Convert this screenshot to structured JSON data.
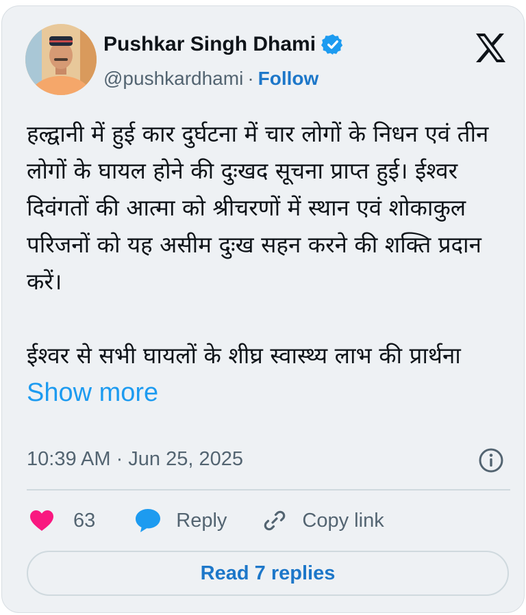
{
  "author": {
    "name": "Pushkar Singh Dhami",
    "handle": "@pushkardhami",
    "separator": "·",
    "follow_label": "Follow",
    "avatar_icon": "profile-photo",
    "verified_icon": "verified-badge-icon",
    "verified_color": "#1d9bf0"
  },
  "platform": {
    "logo_icon": "x-logo-icon"
  },
  "tweet": {
    "paragraph_1": "हल्द्वानी में हुई कार दुर्घटना में चार लोगों के निधन एवं तीन लोगों के घायल होने की दुःखद सूचना प्राप्त हुई। ईश्वर दिवंगतों की आत्मा को श्रीचरणों में स्थान एवं शोकाकुल परिजनों को यह असीम दुःख सहन करने की शक्ति प्रदान करें।",
    "paragraph_2": "ईश्वर से सभी घायलों के शीघ्र स्वास्थ्य लाभ की प्रार्थना",
    "show_more_label": "Show more",
    "timestamp": "10:39 AM · Jun 25, 2025"
  },
  "actions": {
    "like_count": "63",
    "like_color": "#f91880",
    "reply_label": "Reply",
    "reply_color": "#1d9bf0",
    "copy_link_label": "Copy link"
  },
  "read_replies_label": "Read 7 replies",
  "colors": {
    "card_background": "#eef1f4",
    "link_blue": "#1d77c9",
    "muted_text": "#536471"
  }
}
